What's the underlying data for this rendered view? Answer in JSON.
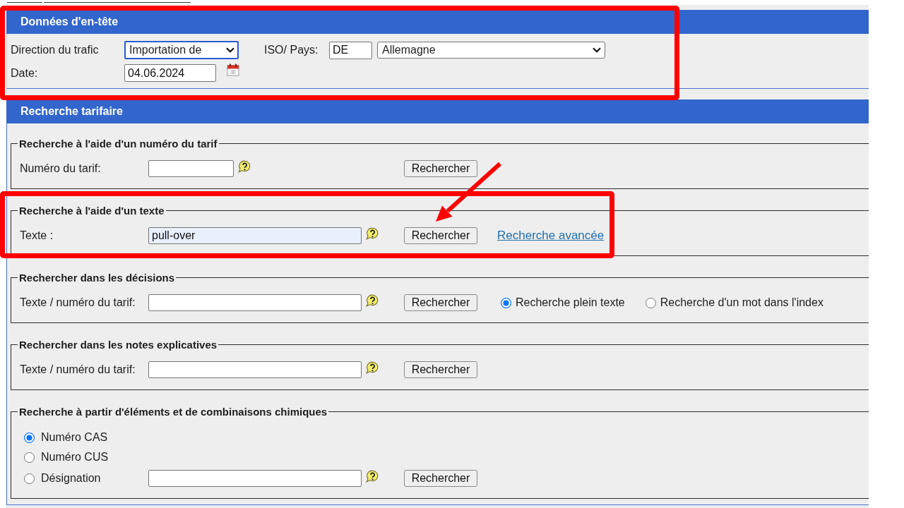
{
  "header_panel": {
    "title": "Données d'en-tête",
    "highlighted": true,
    "traffic_direction": {
      "label": "Direction du trafic",
      "value": "Importation de",
      "focused": true
    },
    "country": {
      "label": "ISO/ Pays:",
      "code": "DE",
      "name": "Allemagne"
    },
    "date": {
      "label": "Date:",
      "value": "04.06.2024"
    }
  },
  "tariff_search": {
    "title": "Recherche tarifaire",
    "sections": [
      {
        "kind": "field",
        "title": "Recherche à l'aide d'un numéro du tarif",
        "highlighted": false,
        "arrow": false,
        "label": "Numéro du tarif:",
        "input": {
          "kind": "short",
          "autofilled": false
        },
        "button": "Rechercher"
      },
      {
        "kind": "field",
        "title": "Recherche à l'aide d'un texte",
        "highlighted": true,
        "arrow": true,
        "label": "Texte :",
        "input": {
          "kind": "long",
          "value": "pull-over",
          "autofilled": true
        },
        "button": "Rechercher",
        "link": "Recherche avancée"
      },
      {
        "kind": "field",
        "title": "Rechercher dans les décisions",
        "highlighted": false,
        "arrow": false,
        "label": "Texte / numéro du tarif:",
        "input": {
          "kind": "long",
          "autofilled": false
        },
        "button": "Rechercher",
        "options": [
          {
            "label": "Recherche plein texte",
            "selected": true
          },
          {
            "label": "Recherche d'un mot dans l'index",
            "selected": false
          }
        ]
      },
      {
        "kind": "field",
        "title": "Rechercher dans les notes explicatives",
        "highlighted": false,
        "arrow": false,
        "label": "Texte / numéro du tarif:",
        "input": {
          "kind": "long",
          "autofilled": false
        },
        "button": "Rechercher"
      },
      {
        "kind": "choice",
        "title": "Recherche à partir d'éléments et de combinaisons chimiques",
        "highlighted": false,
        "arrow": false,
        "options": [
          {
            "label": "Numéro CAS",
            "selected": true
          },
          {
            "label": "Numéro CUS",
            "selected": false
          },
          {
            "label": "Désignation",
            "selected": false
          }
        ],
        "input": {
          "kind": "long",
          "autofilled": false
        },
        "button": "Rechercher"
      }
    ]
  }
}
